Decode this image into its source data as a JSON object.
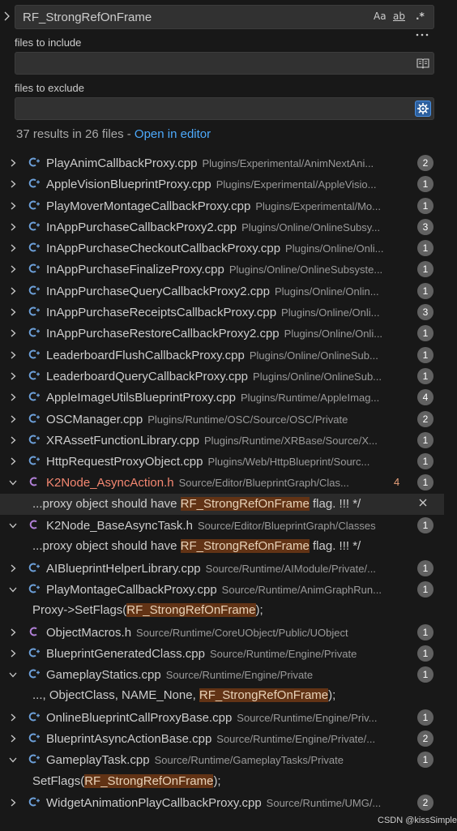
{
  "search": {
    "query": "RF_StrongRefOnFrame",
    "match_case_label": "Aa",
    "whole_word_label": "ab",
    "regex_label": ".*"
  },
  "include": {
    "label": "files to include",
    "value": ""
  },
  "exclude": {
    "label": "files to exclude",
    "value": ""
  },
  "summary": {
    "text": "37 results in 26 files - ",
    "link": "Open in editor"
  },
  "results": [
    {
      "kind": "file",
      "icon": "cpp",
      "name": "PlayAnimCallbackProxy.cpp",
      "path": "Plugins/Experimental/AnimNextAni...",
      "count": "2",
      "expanded": false
    },
    {
      "kind": "file",
      "icon": "cpp",
      "name": "AppleVisionBlueprintProxy.cpp",
      "path": "Plugins/Experimental/AppleVisio...",
      "count": "1",
      "expanded": false
    },
    {
      "kind": "file",
      "icon": "cpp",
      "name": "PlayMoverMontageCallbackProxy.cpp",
      "path": "Plugins/Experimental/Mo...",
      "count": "1",
      "expanded": false
    },
    {
      "kind": "file",
      "icon": "cpp",
      "name": "InAppPurchaseCallbackProxy2.cpp",
      "path": "Plugins/Online/OnlineSubsy...",
      "count": "3",
      "expanded": false
    },
    {
      "kind": "file",
      "icon": "cpp",
      "name": "InAppPurchaseCheckoutCallbackProxy.cpp",
      "path": "Plugins/Online/Onli...",
      "count": "1",
      "expanded": false
    },
    {
      "kind": "file",
      "icon": "cpp",
      "name": "InAppPurchaseFinalizeProxy.cpp",
      "path": "Plugins/Online/OnlineSubsyste...",
      "count": "1",
      "expanded": false
    },
    {
      "kind": "file",
      "icon": "cpp",
      "name": "InAppPurchaseQueryCallbackProxy2.cpp",
      "path": "Plugins/Online/Onlin...",
      "count": "1",
      "expanded": false
    },
    {
      "kind": "file",
      "icon": "cpp",
      "name": "InAppPurchaseReceiptsCallbackProxy.cpp",
      "path": "Plugins/Online/Onli...",
      "count": "3",
      "expanded": false
    },
    {
      "kind": "file",
      "icon": "cpp",
      "name": "InAppPurchaseRestoreCallbackProxy2.cpp",
      "path": "Plugins/Online/Onli...",
      "count": "1",
      "expanded": false
    },
    {
      "kind": "file",
      "icon": "cpp",
      "name": "LeaderboardFlushCallbackProxy.cpp",
      "path": "Plugins/Online/OnlineSub...",
      "count": "1",
      "expanded": false
    },
    {
      "kind": "file",
      "icon": "cpp",
      "name": "LeaderboardQueryCallbackProxy.cpp",
      "path": "Plugins/Online/OnlineSub...",
      "count": "1",
      "expanded": false
    },
    {
      "kind": "file",
      "icon": "cpp",
      "name": "AppleImageUtilsBlueprintProxy.cpp",
      "path": "Plugins/Runtime/AppleImag...",
      "count": "4",
      "expanded": false
    },
    {
      "kind": "file",
      "icon": "cpp",
      "name": "OSCManager.cpp",
      "path": "Plugins/Runtime/OSC/Source/OSC/Private",
      "count": "2",
      "expanded": false
    },
    {
      "kind": "file",
      "icon": "cpp",
      "name": "XRAssetFunctionLibrary.cpp",
      "path": "Plugins/Runtime/XRBase/Source/X...",
      "count": "1",
      "expanded": false
    },
    {
      "kind": "file",
      "icon": "cpp",
      "name": "HttpRequestProxyObject.cpp",
      "path": "Plugins/Web/HttpBlueprint/Sourc...",
      "count": "1",
      "expanded": false
    },
    {
      "kind": "file",
      "icon": "h",
      "name": "K2Node_AsyncAction.h",
      "path": "Source/Editor/BlueprintGraph/Clas...",
      "count": "1",
      "expanded": true,
      "error": "4"
    },
    {
      "kind": "match",
      "before": "...proxy object should have ",
      "match": "RF_StrongRefOnFrame",
      "after": " flag. !!! */",
      "selected": true
    },
    {
      "kind": "file",
      "icon": "h",
      "name": "K2Node_BaseAsyncTask.h",
      "path": "Source/Editor/BlueprintGraph/Classes",
      "count": "1",
      "expanded": true
    },
    {
      "kind": "match",
      "before": "...proxy object should have ",
      "match": "RF_StrongRefOnFrame",
      "after": " flag. !!! */"
    },
    {
      "kind": "file",
      "icon": "cpp",
      "name": "AIBlueprintHelperLibrary.cpp",
      "path": "Source/Runtime/AIModule/Private/...",
      "count": "1",
      "expanded": false
    },
    {
      "kind": "file",
      "icon": "cpp",
      "name": "PlayMontageCallbackProxy.cpp",
      "path": "Source/Runtime/AnimGraphRun...",
      "count": "1",
      "expanded": true
    },
    {
      "kind": "match",
      "before": "Proxy->SetFlags(",
      "match": "RF_StrongRefOnFrame",
      "after": ");"
    },
    {
      "kind": "file",
      "icon": "h",
      "name": "ObjectMacros.h",
      "path": "Source/Runtime/CoreUObject/Public/UObject",
      "count": "1",
      "expanded": false
    },
    {
      "kind": "file",
      "icon": "cpp",
      "name": "BlueprintGeneratedClass.cpp",
      "path": "Source/Runtime/Engine/Private",
      "count": "1",
      "expanded": false
    },
    {
      "kind": "file",
      "icon": "cpp",
      "name": "GameplayStatics.cpp",
      "path": "Source/Runtime/Engine/Private",
      "count": "1",
      "expanded": true
    },
    {
      "kind": "match",
      "before": "..., ObjectClass, NAME_None, ",
      "match": "RF_StrongRefOnFrame",
      "after": ");"
    },
    {
      "kind": "file",
      "icon": "cpp",
      "name": "OnlineBlueprintCallProxyBase.cpp",
      "path": "Source/Runtime/Engine/Priv...",
      "count": "1",
      "expanded": false
    },
    {
      "kind": "file",
      "icon": "cpp",
      "name": "BlueprintAsyncActionBase.cpp",
      "path": "Source/Runtime/Engine/Private/...",
      "count": "2",
      "expanded": false
    },
    {
      "kind": "file",
      "icon": "cpp",
      "name": "GameplayTask.cpp",
      "path": "Source/Runtime/GameplayTasks/Private",
      "count": "1",
      "expanded": true
    },
    {
      "kind": "match",
      "before": "SetFlags(",
      "match": "RF_StrongRefOnFrame",
      "after": ");"
    },
    {
      "kind": "file",
      "icon": "cpp",
      "name": "WidgetAnimationPlayCallbackProxy.cpp",
      "path": "Source/Runtime/UMG/...",
      "count": "2",
      "expanded": false
    }
  ],
  "icons": {
    "cpp": "C++ icon (C with plus)",
    "h": "C header icon"
  },
  "colors": {
    "accent_link": "#4daafc",
    "match_highlight": "#623315",
    "error_file": "#f48771",
    "badge": "#616161"
  },
  "watermark": "CSDN @kissSimple"
}
